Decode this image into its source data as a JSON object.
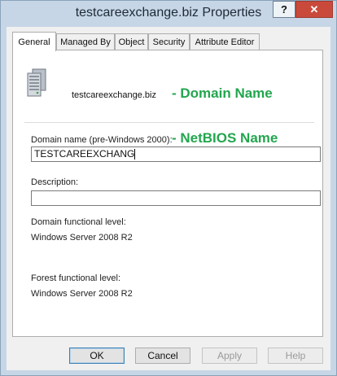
{
  "window": {
    "title": "testcareexchange.biz Properties",
    "help_glyph": "?",
    "close_glyph": "✕"
  },
  "tabs": [
    {
      "label": "General",
      "active": true
    },
    {
      "label": "Managed By",
      "active": false
    },
    {
      "label": "Object",
      "active": false
    },
    {
      "label": "Security",
      "active": false
    },
    {
      "label": "Attribute Editor",
      "active": false
    }
  ],
  "general": {
    "domain_name": "testcareexchange.biz",
    "domain_annotation": "- Domain Name",
    "netbios_label": "Domain name (pre-Windows 2000):",
    "netbios_annotation": "- NetBIOS Name",
    "netbios_value": "TESTCAREEXCHANG",
    "description_label": "Description:",
    "description_value": "",
    "domain_level_label": "Domain functional level:",
    "domain_level_value": "Windows Server 2008 R2",
    "forest_level_label": "Forest functional level:",
    "forest_level_value": "Windows Server 2008 R2"
  },
  "buttons": {
    "ok": "OK",
    "cancel": "Cancel",
    "apply": "Apply",
    "help": "Help"
  },
  "colors": {
    "annotation": "#22a64e",
    "close_button": "#c94a3b"
  },
  "icons": {
    "domain": "server-icon"
  }
}
